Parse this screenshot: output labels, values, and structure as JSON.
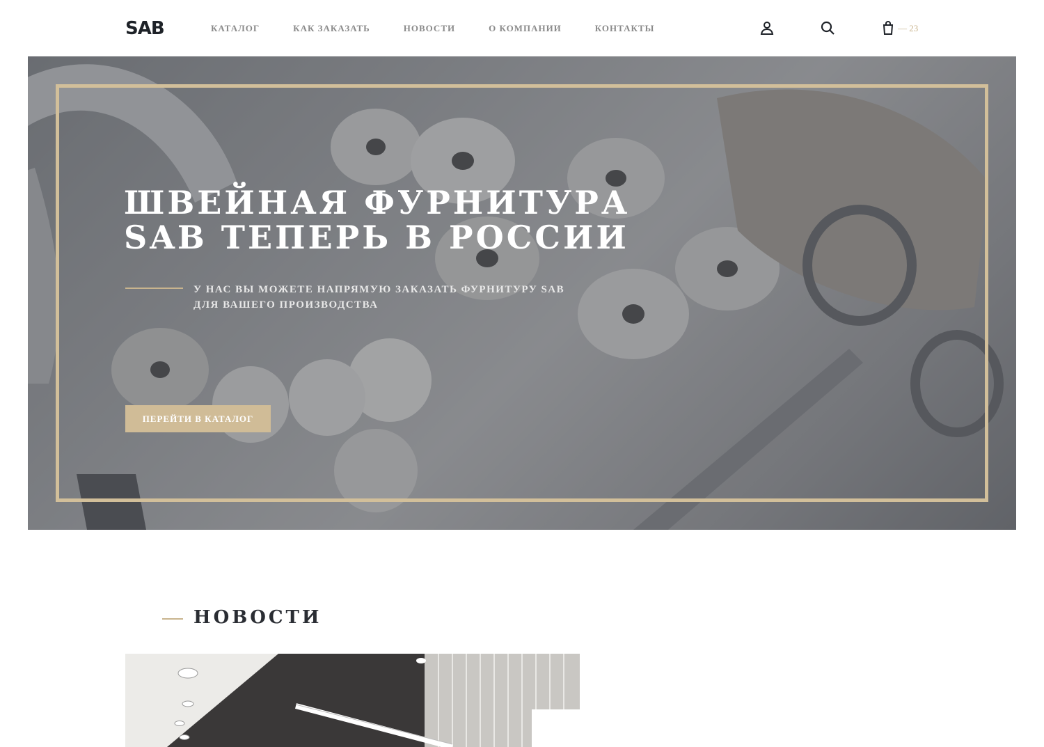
{
  "header": {
    "logo": "SAB",
    "nav": [
      "Каталог",
      "Как заказать",
      "Новости",
      "О компании",
      "Контакты"
    ],
    "icons": {
      "account": "user-icon",
      "search": "search-icon",
      "cart": "shopping-bag-icon"
    },
    "cart_count": "— 23"
  },
  "hero": {
    "title": "Швейная фурнитура SAB теперь в России",
    "subtitle": "У нас вы можете напрямую заказать фурнитуру SAB для вашего производства",
    "button_label": "Перейти в каталог",
    "accent_color": "#d0bc97"
  },
  "news": {
    "heading": "Новости"
  }
}
